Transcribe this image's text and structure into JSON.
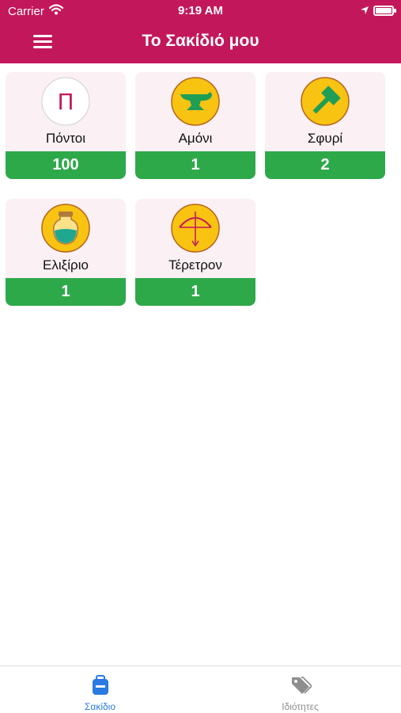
{
  "status_bar": {
    "carrier": "Carrier",
    "time": "9:19 AM"
  },
  "header": {
    "title": "Το Σακίδιό μου",
    "menu_icon": "hamburger-menu-icon"
  },
  "items": [
    {
      "label": "Πόντοι",
      "count": "100",
      "icon": "points-letter-icon",
      "icon_letter": "Π"
    },
    {
      "label": "Αμόνι",
      "count": "1",
      "icon": "anvil-icon"
    },
    {
      "label": "Σφυρί",
      "count": "2",
      "icon": "hammer-icon"
    },
    {
      "label": "Ελιξίριο",
      "count": "1",
      "icon": "elixir-jar-icon"
    },
    {
      "label": "Τέρετρον",
      "count": "1",
      "icon": "bow-drill-icon"
    }
  ],
  "tabs": [
    {
      "label": "Σακίδιο",
      "icon": "backpack-icon",
      "active": true
    },
    {
      "label": "Ιδιότητες",
      "icon": "tags-icon",
      "active": false
    }
  ],
  "colors": {
    "header": "#c2185b",
    "count_bar": "#2ea94a",
    "card_bg": "#fbf0f4",
    "icon_gold": "#f9c312",
    "tab_active": "#2a7ae2",
    "tab_inactive": "#8e8e8e"
  }
}
